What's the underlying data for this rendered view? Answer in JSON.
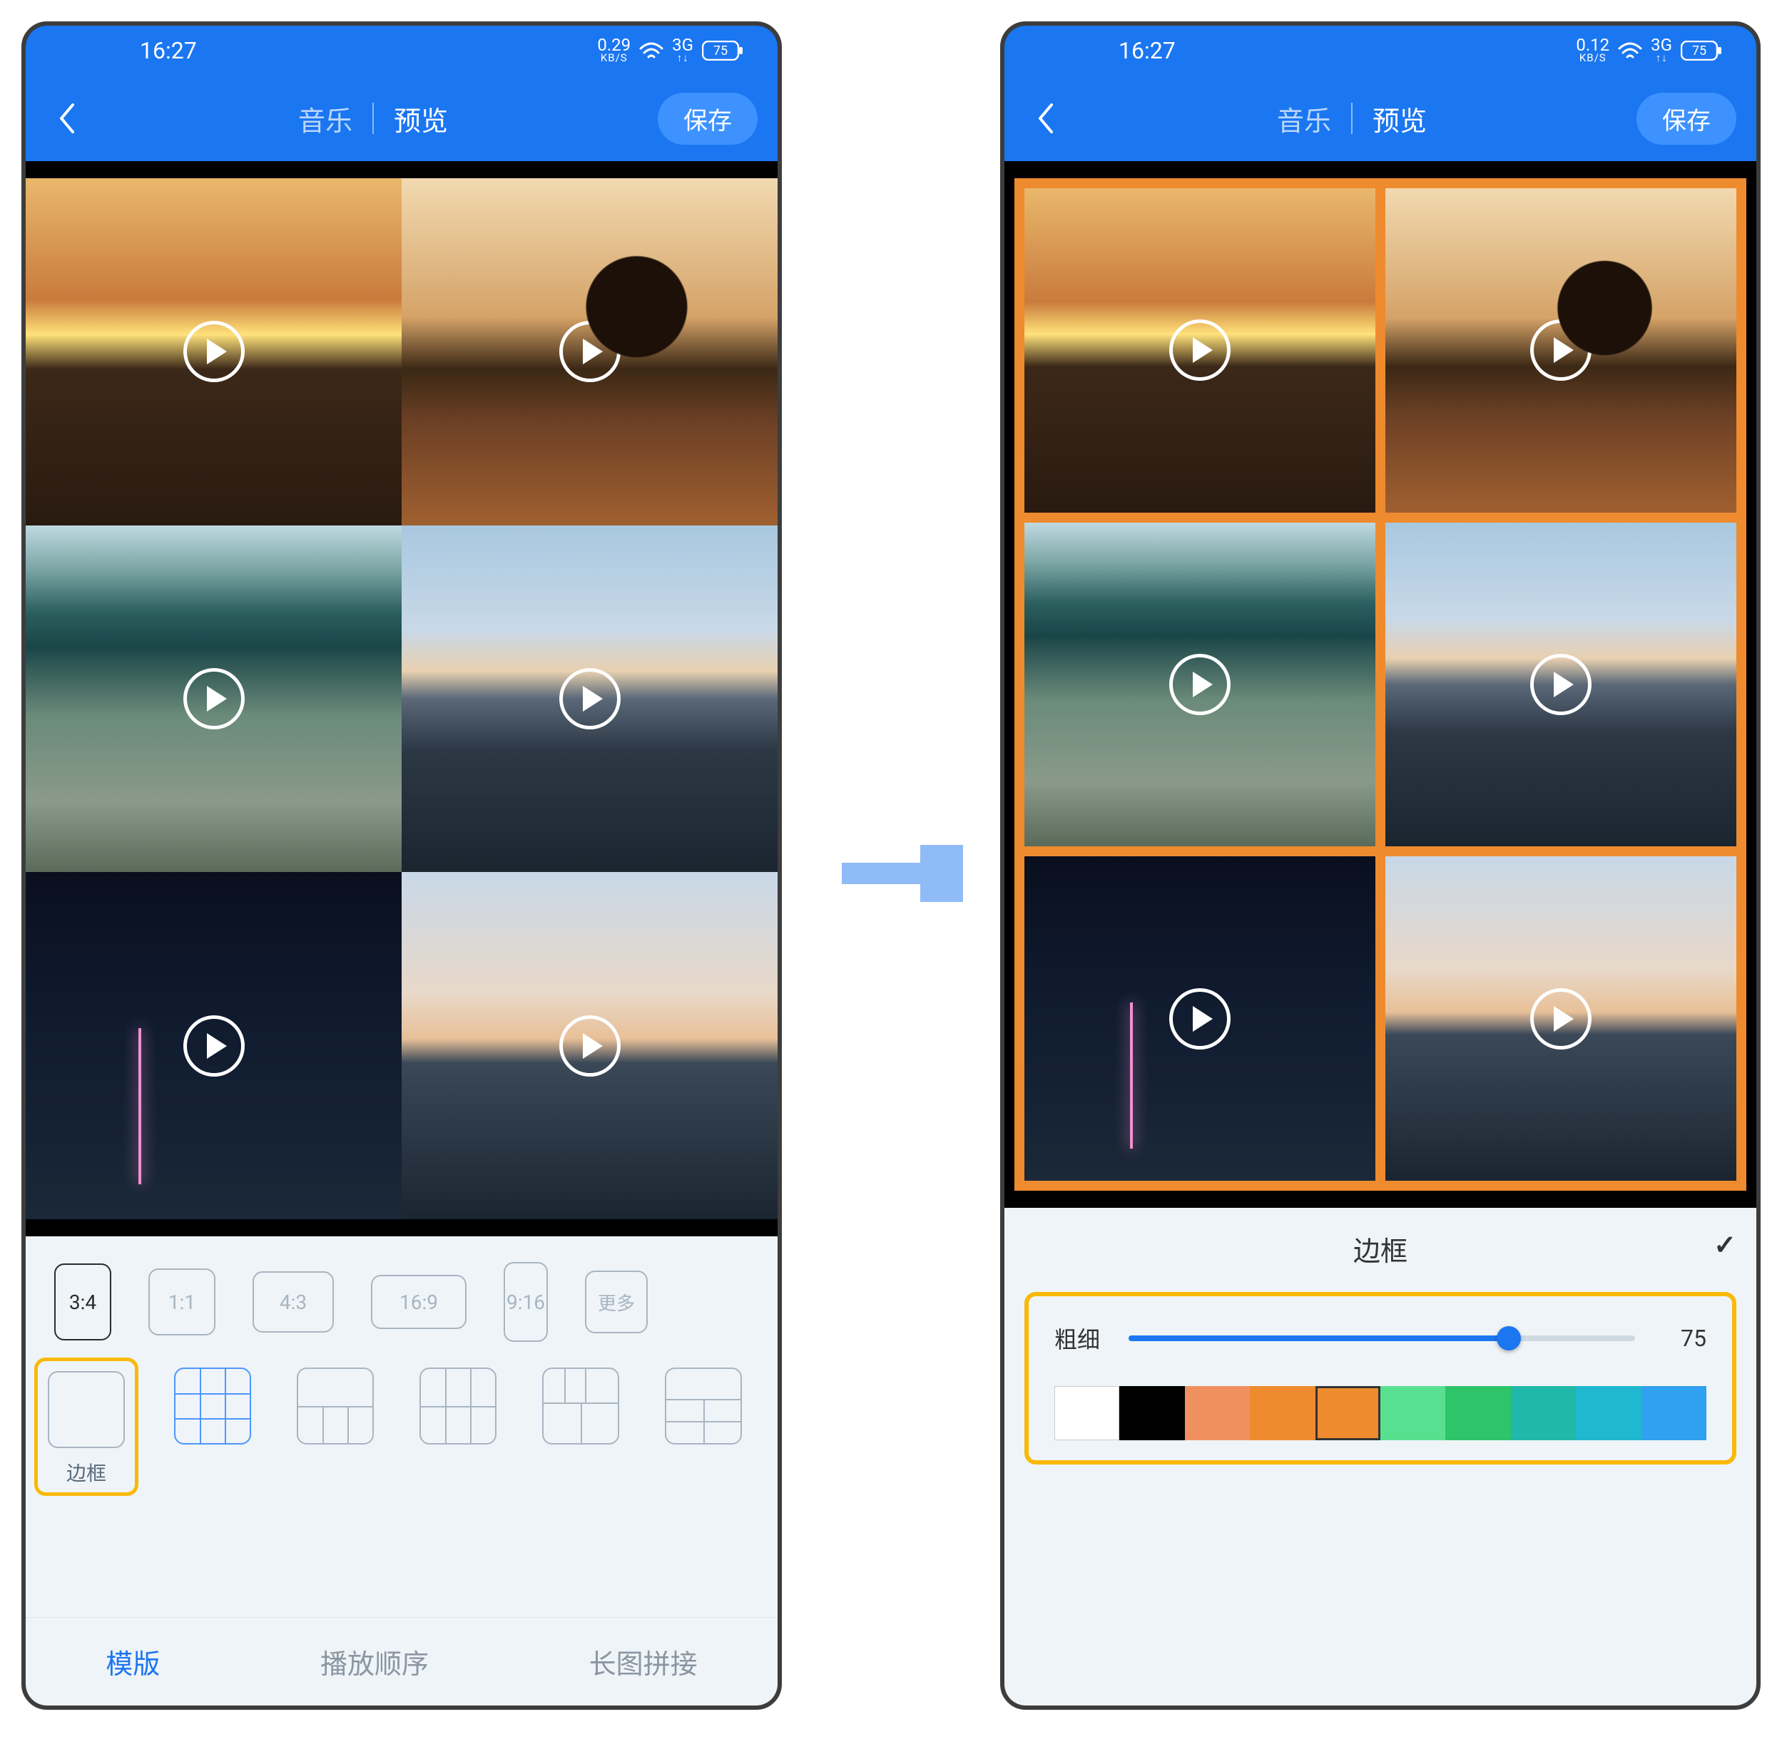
{
  "status": {
    "time": "16:27",
    "speed_left": "0.29",
    "speed_right": "0.12",
    "speed_unit": "KB/S",
    "net": "3G",
    "battery": "75"
  },
  "header": {
    "music": "音乐",
    "preview": "预览",
    "save": "保存"
  },
  "ratios": {
    "r34": "3:4",
    "r11": "1:1",
    "r43": "4:3",
    "r169": "16:9",
    "r916": "9:16",
    "more": "更多"
  },
  "layouts": {
    "border": "边框"
  },
  "tabs": {
    "template": "模版",
    "order": "播放顺序",
    "long": "长图拼接"
  },
  "border_panel": {
    "title": "边框",
    "thickness_label": "粗细",
    "thickness_value": "75",
    "colors": [
      "#FFFFFF",
      "#000000",
      "#F09060",
      "#EE8B2F",
      "#EE8B2F",
      "#58E090",
      "#2EC46A",
      "#20B8A8",
      "#20B8D0",
      "#30A0F0"
    ]
  }
}
